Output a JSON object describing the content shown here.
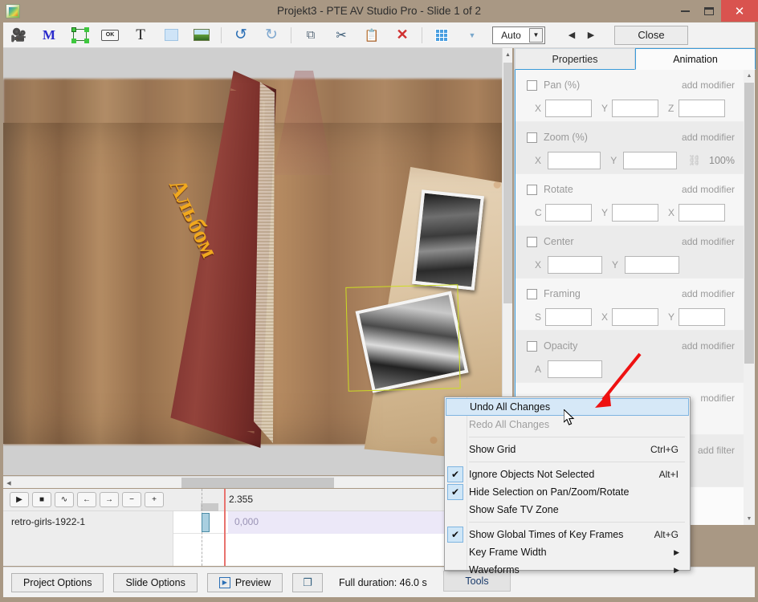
{
  "window": {
    "title": "Projekt3 - PTE AV Studio Pro - Slide 1 of 2",
    "app_icon": "app-logo-icon",
    "minimize": "–",
    "maximize": "□",
    "close": "✕"
  },
  "toolbar": {
    "items": [
      {
        "name": "video-clip-icon",
        "glyph": "🎥"
      },
      {
        "name": "mask-icon",
        "glyph": "M"
      },
      {
        "name": "frame-icon",
        "glyph": ""
      },
      {
        "name": "button-object-icon",
        "glyph": "OK"
      },
      {
        "name": "text-object-icon",
        "glyph": "T"
      },
      {
        "name": "rectangle-object-icon",
        "glyph": ""
      },
      {
        "name": "image-object-icon",
        "glyph": ""
      },
      {
        "name": "undo-icon",
        "glyph": "↺"
      },
      {
        "name": "redo-icon",
        "glyph": "↻"
      },
      {
        "name": "copy-icon",
        "glyph": "⧉"
      },
      {
        "name": "cut-icon",
        "glyph": "✂"
      },
      {
        "name": "paste-icon",
        "glyph": "📋"
      },
      {
        "name": "delete-icon",
        "glyph": "✕"
      },
      {
        "name": "grid-icon",
        "glyph": ""
      },
      {
        "name": "grid-dropdown-icon",
        "glyph": "▾"
      }
    ],
    "zoom_select": {
      "value": "Auto",
      "arrow": "▼"
    },
    "nav_prev": "◀",
    "nav_next": "▶",
    "close_label": "Close"
  },
  "preview": {
    "album_title": "Альбом",
    "selection": "selection-rectangle"
  },
  "right_panel": {
    "tabs": [
      {
        "label": "Properties",
        "active": false
      },
      {
        "label": "Animation",
        "active": true
      }
    ],
    "add_modifier_label": "add modifier",
    "add_filter_label": "add filter",
    "modifier_partial_label": "modifier",
    "rows": [
      {
        "name": "pan",
        "label": "Pan (%)",
        "checked": false,
        "fields": [
          {
            "label": "X",
            "value": ""
          },
          {
            "label": "Y",
            "value": ""
          },
          {
            "label": "Z",
            "value": ""
          }
        ]
      },
      {
        "name": "zoom",
        "label": "Zoom (%)",
        "checked": false,
        "fields": [
          {
            "label": "X",
            "value": ""
          },
          {
            "label": "Y",
            "value": ""
          }
        ],
        "link_icon": "chain-link-icon",
        "percent": "100%"
      },
      {
        "name": "rotate",
        "label": "Rotate",
        "checked": false,
        "fields": [
          {
            "label": "C",
            "value": ""
          },
          {
            "label": "Y",
            "value": ""
          },
          {
            "label": "X",
            "value": ""
          }
        ]
      },
      {
        "name": "center",
        "label": "Center",
        "checked": false,
        "fields": [
          {
            "label": "X",
            "value": ""
          },
          {
            "label": "Y",
            "value": ""
          }
        ]
      },
      {
        "name": "framing",
        "label": "Framing",
        "checked": false,
        "fields": [
          {
            "label": "S",
            "value": ""
          },
          {
            "label": "X",
            "value": ""
          },
          {
            "label": "Y",
            "value": ""
          }
        ]
      },
      {
        "name": "opacity",
        "label": "Opacity",
        "checked": false,
        "fields": [
          {
            "label": "A",
            "value": ""
          }
        ]
      }
    ]
  },
  "context_menu": {
    "items": [
      {
        "label": "Undo All Changes",
        "checked": false,
        "disabled": false,
        "selected": true,
        "accel": "",
        "submenu": false
      },
      {
        "label": "Redo All Changes",
        "checked": false,
        "disabled": true,
        "selected": false,
        "accel": "",
        "submenu": false
      },
      {
        "separator": true
      },
      {
        "label": "Show Grid",
        "checked": false,
        "disabled": false,
        "selected": false,
        "accel": "Ctrl+G",
        "submenu": false
      },
      {
        "separator": true
      },
      {
        "label": "Ignore Objects Not Selected",
        "checked": true,
        "disabled": false,
        "selected": false,
        "accel": "Alt+I",
        "submenu": false
      },
      {
        "label": "Hide Selection on Pan/Zoom/Rotate",
        "checked": true,
        "disabled": false,
        "selected": false,
        "accel": "",
        "submenu": false
      },
      {
        "label": "Show Safe TV Zone",
        "checked": false,
        "disabled": false,
        "selected": false,
        "accel": "",
        "submenu": false
      },
      {
        "separator": true
      },
      {
        "label": "Show Global Times of Key Frames",
        "checked": true,
        "disabled": false,
        "selected": false,
        "accel": "Alt+G",
        "submenu": false
      },
      {
        "label": "Key Frame Width",
        "checked": false,
        "disabled": false,
        "selected": false,
        "accel": "",
        "submenu": true
      },
      {
        "label": "Waveforms",
        "checked": false,
        "disabled": false,
        "selected": false,
        "accel": "",
        "submenu": true
      }
    ],
    "check_glyph": "✔",
    "submenu_glyph": "▶"
  },
  "timeline": {
    "buttons": [
      {
        "name": "play-button",
        "glyph": "▶"
      },
      {
        "name": "stop-button",
        "glyph": "■"
      },
      {
        "name": "waveform-button",
        "glyph": "∿"
      },
      {
        "name": "prev-keyframe-button",
        "glyph": "←"
      },
      {
        "name": "next-keyframe-button",
        "glyph": "→"
      },
      {
        "name": "zoom-out-button",
        "glyph": "−"
      },
      {
        "name": "zoom-in-button",
        "glyph": "+"
      }
    ],
    "ruler_time": "2.355",
    "track_name": "retro-girls-1922-1",
    "keyframe_time": "0,000"
  },
  "bottom_bar": {
    "project_options": "Project Options",
    "slide_options": "Slide Options",
    "preview": "Preview",
    "preview_icon": "play-preview-icon",
    "duplicate_icon": "duplicate-window-icon",
    "duration": "Full duration: 46.0 s",
    "tools": "Tools"
  },
  "colors": {
    "accent": "#3a9ad9",
    "close_red": "#d9534f",
    "menu_highlight": "#d6e8f7",
    "annotation_arrow": "#ee1111",
    "selection_outline": "#cddd22",
    "title_gold": "#f0a81e",
    "chrome": "#a99884"
  }
}
